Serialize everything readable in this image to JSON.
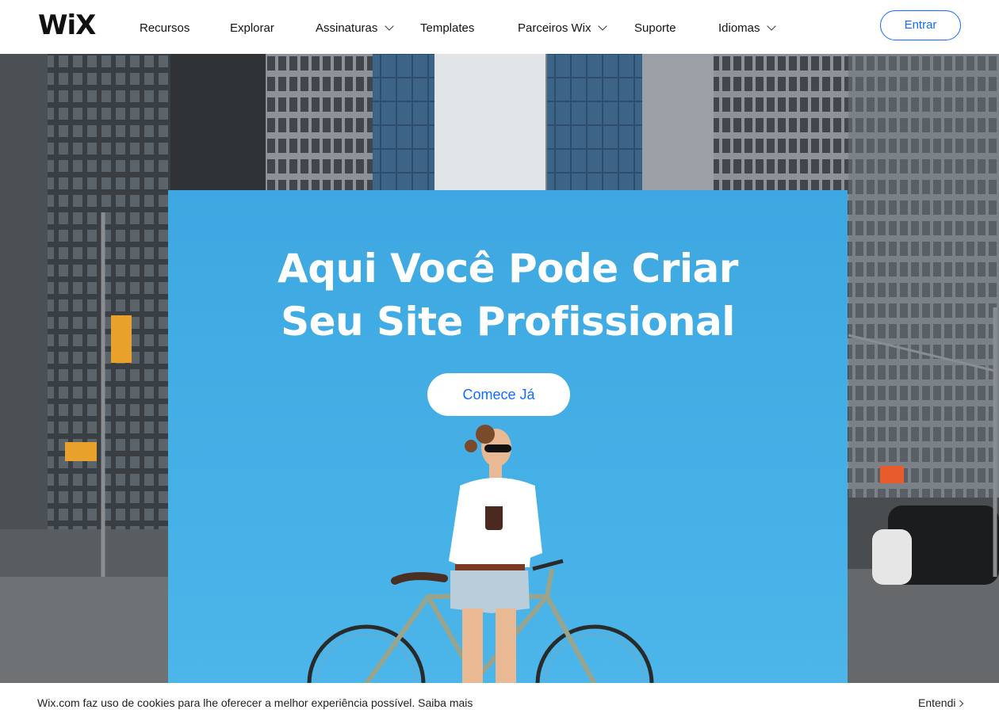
{
  "brand": {
    "logo": "WiX",
    "accent_color": "#116dff"
  },
  "header": {
    "nav": [
      {
        "label": "Recursos",
        "has_dropdown": false
      },
      {
        "label": "Explorar",
        "has_dropdown": false
      },
      {
        "label": "Assinaturas",
        "has_dropdown": true
      },
      {
        "label": "Templates",
        "has_dropdown": false
      },
      {
        "label": "Parceiros Wix",
        "has_dropdown": true
      },
      {
        "label": "Suporte",
        "has_dropdown": false
      },
      {
        "label": "Idiomas",
        "has_dropdown": true
      }
    ],
    "login_label": "Entrar"
  },
  "hero": {
    "title_line1": "Aqui Você Pode Criar",
    "title_line2": "Seu Site Profissional",
    "cta_label": "Comece Já",
    "panel_color": "#42ade4"
  },
  "cookie_bar": {
    "text": "Wix.com faz uso de cookies para lhe oferecer a melhor experiência possível.",
    "link_label": "Saiba mais",
    "accept_label": "Entendi"
  }
}
